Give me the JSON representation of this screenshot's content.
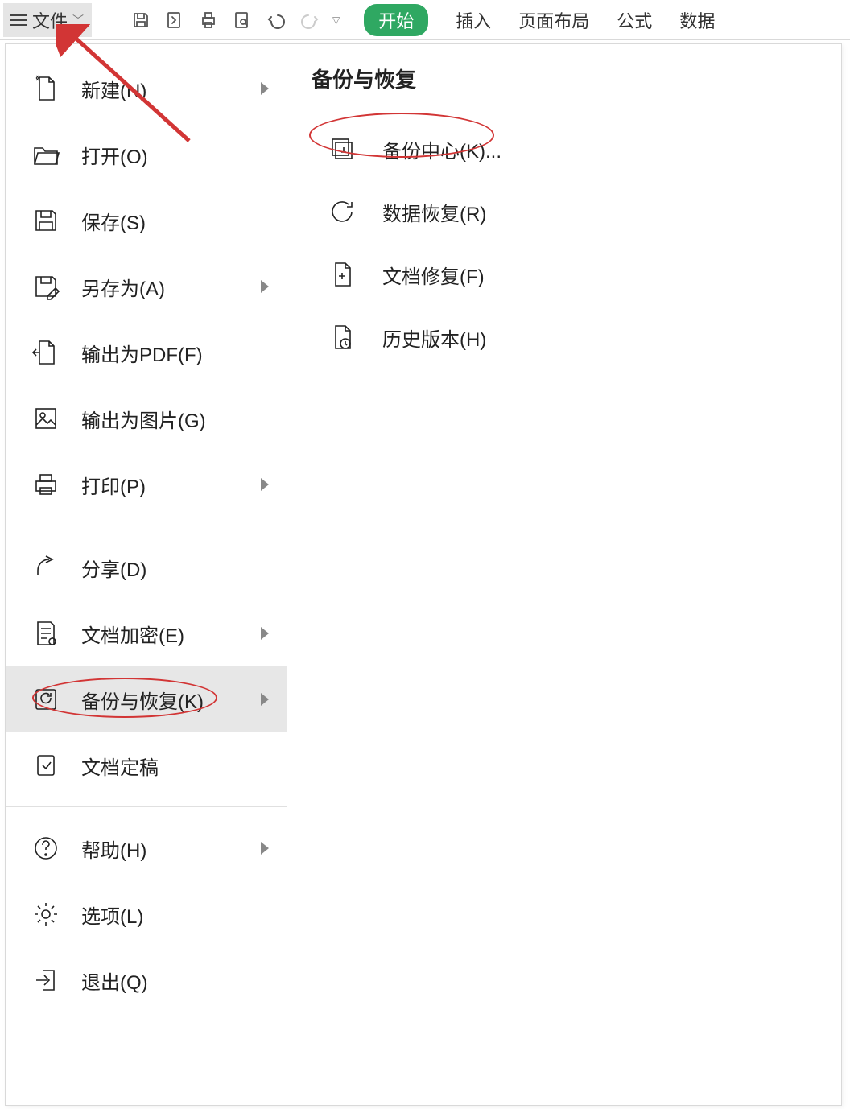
{
  "toolbar": {
    "file_label": "文件",
    "tabs": {
      "start": "开始",
      "insert": "插入",
      "page_layout": "页面布局",
      "formula": "公式",
      "data": "数据"
    }
  },
  "file_menu": {
    "items": [
      {
        "label": "新建(N)",
        "has_arrow": true
      },
      {
        "label": "打开(O)",
        "has_arrow": false
      },
      {
        "label": "保存(S)",
        "has_arrow": false
      },
      {
        "label": "另存为(A)",
        "has_arrow": true
      },
      {
        "label": "输出为PDF(F)",
        "has_arrow": false
      },
      {
        "label": "输出为图片(G)",
        "has_arrow": false
      },
      {
        "label": "打印(P)",
        "has_arrow": true
      },
      {
        "label": "分享(D)",
        "has_arrow": false
      },
      {
        "label": "文档加密(E)",
        "has_arrow": true
      },
      {
        "label": "备份与恢复(K)",
        "has_arrow": true
      },
      {
        "label": "文档定稿",
        "has_arrow": false
      },
      {
        "label": "帮助(H)",
        "has_arrow": true
      },
      {
        "label": "选项(L)",
        "has_arrow": false
      },
      {
        "label": "退出(Q)",
        "has_arrow": false
      }
    ]
  },
  "sub_panel": {
    "title": "备份与恢复",
    "items": [
      {
        "label": "备份中心(K)..."
      },
      {
        "label": "数据恢复(R)"
      },
      {
        "label": "文档修复(F)"
      },
      {
        "label": "历史版本(H)"
      }
    ]
  },
  "annotations": {
    "ellipse_menu_item": "备份与恢复(K)",
    "ellipse_sub_item": "备份中心(K)...",
    "arrow_target": "文件"
  }
}
